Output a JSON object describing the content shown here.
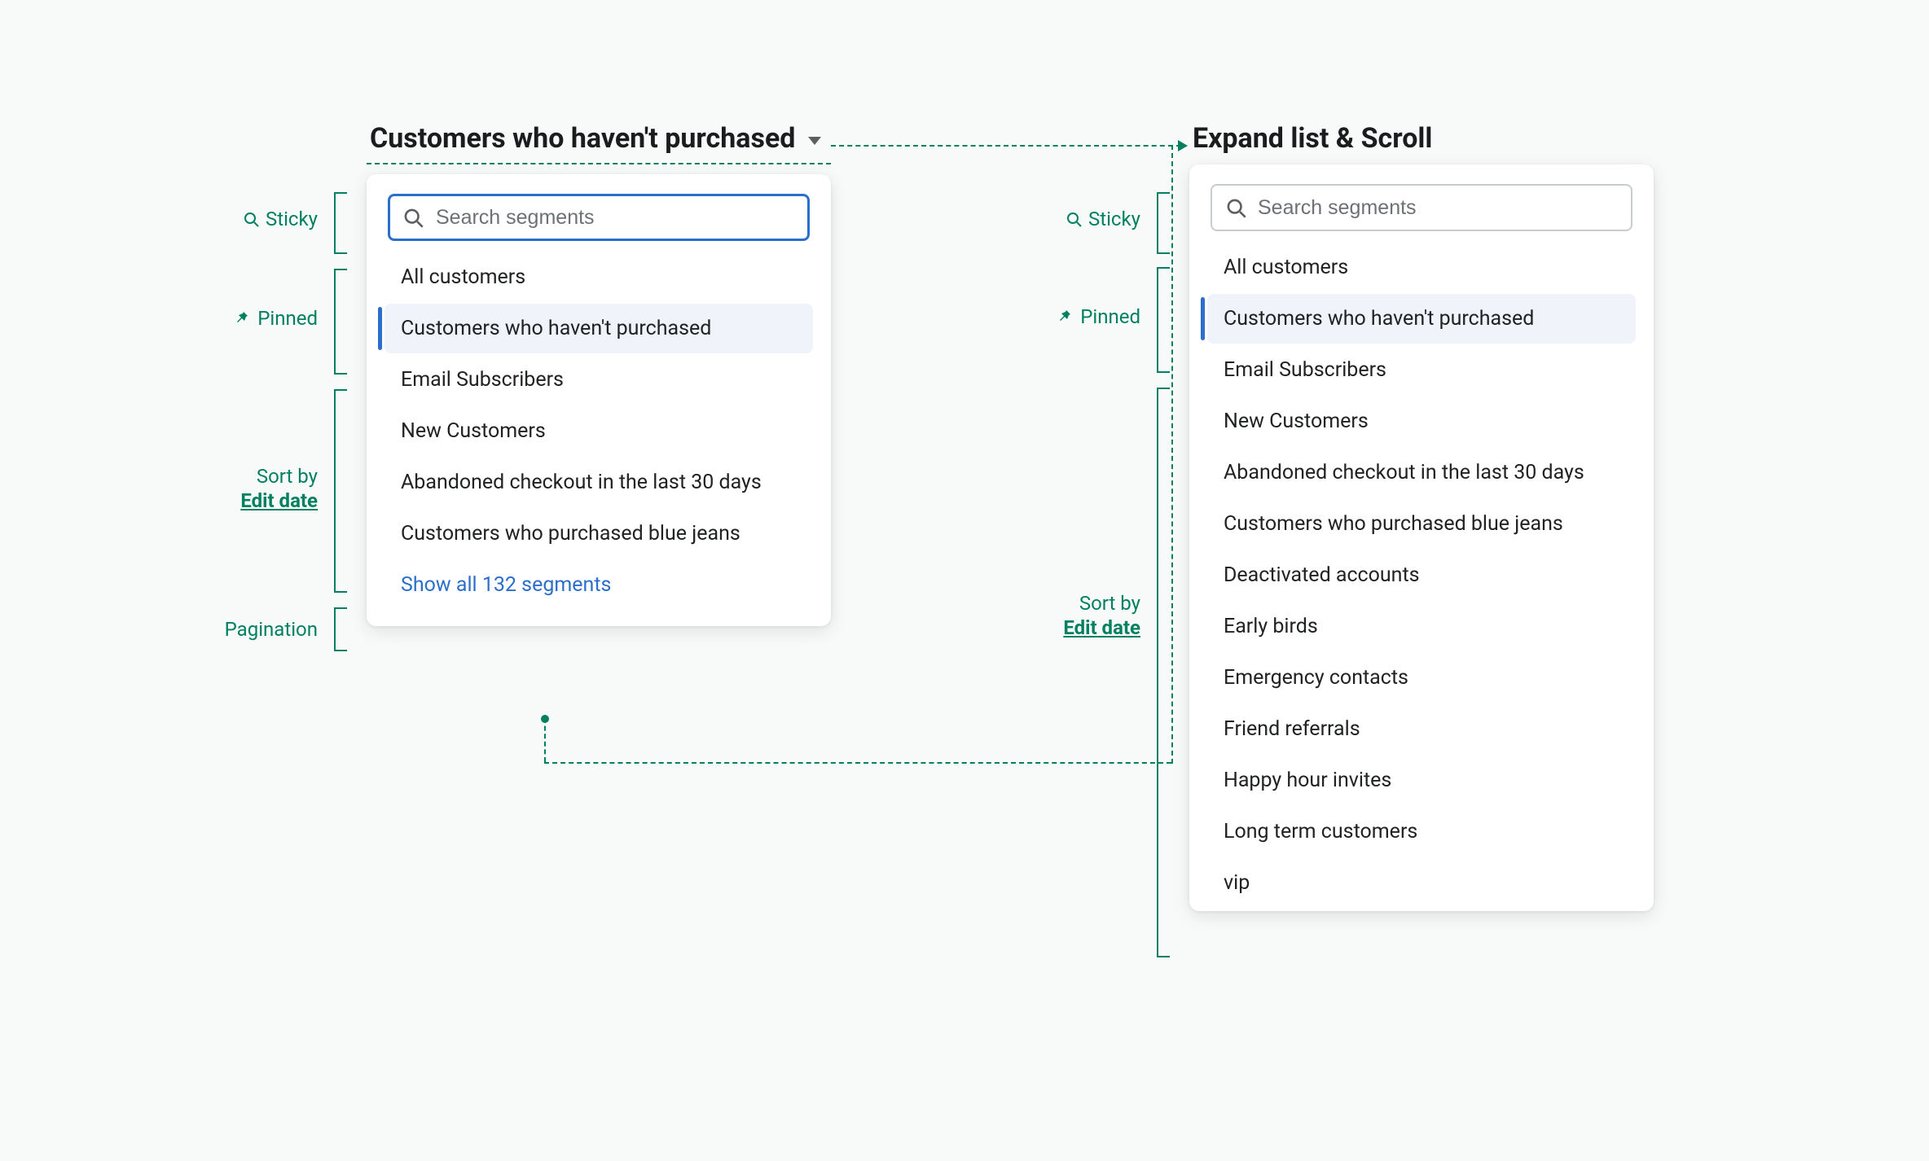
{
  "left": {
    "trigger_label": "Customers who haven't purchased",
    "search_placeholder": "Search segments",
    "items": [
      "All customers",
      "Customers who haven't purchased",
      "Email Subscribers",
      "New Customers",
      "Abandoned checkout in the last 30 days",
      "Customers who purchased blue jeans"
    ],
    "show_all_label": "Show all 132 segments"
  },
  "right": {
    "title": "Expand list & Scroll",
    "search_placeholder": "Search segments",
    "items": [
      "All customers",
      "Customers who haven't purchased",
      "Email Subscribers",
      "New Customers",
      "Abandoned checkout in the last 30 days",
      "Customers who purchased blue jeans",
      "Deactivated accounts",
      "Early birds",
      "Emergency contacts",
      "Friend referrals",
      "Happy hour invites",
      "Long term customers",
      "vip"
    ]
  },
  "annotations": {
    "sticky": "Sticky",
    "pinned": "Pinned",
    "sort_by": "Sort by",
    "edit_date": "Edit date",
    "pagination": "Pagination"
  },
  "selected_item": "Customers who haven't purchased",
  "colors": {
    "accent_green": "#008060",
    "accent_blue": "#2c6ecb",
    "text": "#202223",
    "panel_bg": "#ffffff"
  }
}
